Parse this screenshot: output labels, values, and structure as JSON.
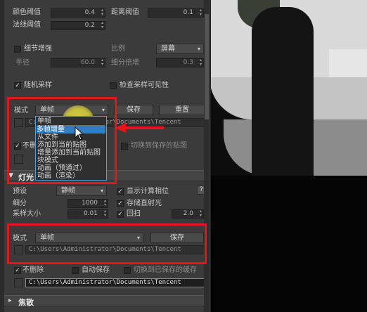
{
  "top_section": {
    "color_threshold_label": "颜色阈值",
    "color_threshold_value": "0.4",
    "distance_threshold_label": "距离阈值",
    "distance_threshold_value": "0.1",
    "normal_threshold_label": "法线阈值",
    "normal_threshold_value": "0.2"
  },
  "detail": {
    "detail_enhance_label": "细节增强",
    "scale_label": "比例",
    "scale_value": "屏幕",
    "radius_label": "半径",
    "radius_value": "60.0",
    "subdiv_mult_label": "细分倍增",
    "subdiv_mult_value": "0.3"
  },
  "sampling": {
    "random_sampling_label": "随机采样",
    "check_visibility_label": "检查采样可见性"
  },
  "mode_block": {
    "mode_label": "模式",
    "mode_value": "单帧",
    "save_button": "保存",
    "reset_button": "重置",
    "path_text": "C:\\Users\\Administrator\\Documents\\Tencent Files\\",
    "not_delete_partial": "不删",
    "switch_saved_map": "切换到保存的贴图",
    "menu_items": [
      "单帧",
      "多帧增量",
      "从文件",
      "添加到当前贴图",
      "增量添加到当前贴图",
      "块模式",
      "动画（预通过）",
      "动画（渲染）"
    ]
  },
  "light_cache": {
    "title": "灯光",
    "preset_label": "预设",
    "preset_value": "静帧",
    "show_calc_phase": "显示计算相位",
    "help": "?",
    "subdivs_label": "细分",
    "subdivs_value": "1000",
    "store_direct_light": "存储直射光",
    "sample_size_label": "采样大小",
    "sample_size_value": "0.01",
    "retrace_label": "回扫",
    "retrace_value": "2.0"
  },
  "mode_block2": {
    "mode_label": "模式",
    "mode_value": "单帧",
    "save_button": "保存",
    "path_text": "C:\\Users\\Administrator\\Documents\\Tencent Files\\",
    "not_delete": "不删除",
    "auto_save": "自动保存",
    "switch_cache": "切换到已保存的缓存",
    "path_text2": "C:\\Users\\Administrator\\Documents\\Tencent Files\\"
  },
  "caustics": {
    "title": "焦散"
  },
  "colors": {
    "highlight_red": "#e8141b",
    "menu_selection": "#2f7fc4",
    "panel_bg": "#3b3b3b"
  }
}
